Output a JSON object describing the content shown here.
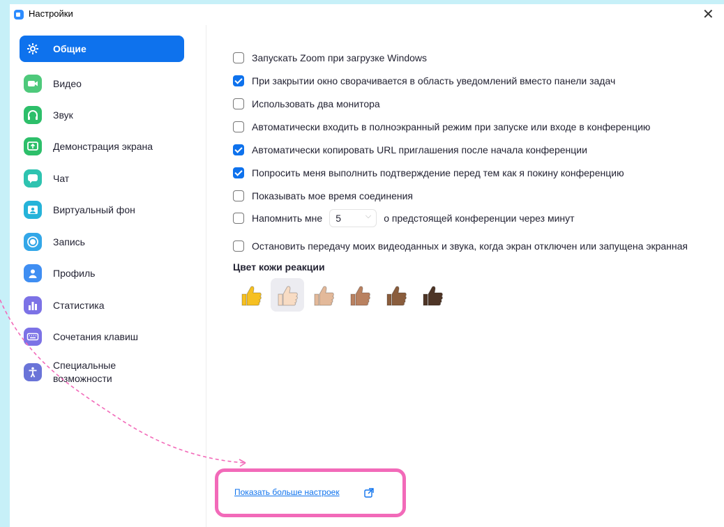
{
  "window": {
    "title": "Настройки"
  },
  "sidebar": {
    "items": [
      {
        "label": "Общие",
        "icon": "gear-icon",
        "color": "#0e72ed",
        "active": true
      },
      {
        "label": "Видео",
        "icon": "video-icon",
        "color": "#4ec97b"
      },
      {
        "label": "Звук",
        "icon": "headphones-icon",
        "color": "#2dbf6a"
      },
      {
        "label": "Демонстрация экрана",
        "icon": "share-screen-icon",
        "color": "#2dbf6a"
      },
      {
        "label": "Чат",
        "icon": "chat-icon",
        "color": "#2ec3b0"
      },
      {
        "label": "Виртуальный фон",
        "icon": "virtual-background-icon",
        "color": "#26b3d9"
      },
      {
        "label": "Запись",
        "icon": "record-icon",
        "color": "#33a7e8"
      },
      {
        "label": "Профиль",
        "icon": "profile-icon",
        "color": "#3f8ef2"
      },
      {
        "label": "Статистика",
        "icon": "statistics-icon",
        "color": "#7c72e6"
      },
      {
        "label": "Сочетания клавиш",
        "icon": "keyboard-icon",
        "color": "#7c72e6"
      },
      {
        "label_line1": "Специальные",
        "label_line2": "возможности",
        "icon": "accessibility-icon",
        "color": "#6a74d8"
      }
    ]
  },
  "general": {
    "options": [
      {
        "label": "Запускать Zoom при загрузке Windows",
        "checked": false
      },
      {
        "label": "При закрытии окно сворачивается в область уведомлений вместо панели задач",
        "checked": true
      },
      {
        "label": "Использовать два монитора",
        "checked": false
      },
      {
        "label": "Автоматически входить в полноэкранный режим при запуске или входе в конференцию",
        "checked": false
      },
      {
        "label": "Автоматически копировать URL приглашения после начала конференции",
        "checked": true
      },
      {
        "label": "Попросить меня выполнить подтверждение перед тем как я покину конференцию",
        "checked": true
      },
      {
        "label": "Показывать мое время соединения",
        "checked": false
      }
    ],
    "reminder": {
      "label_before": "Напомнить мне",
      "minutes": "5",
      "label_after": "о предстоящей конференции через минут",
      "checked": false
    },
    "stop_video": {
      "label": "Остановить передачу моих видеоданных и звука, когда экран отключен или запущена экранная",
      "checked": false
    },
    "skin_tone": {
      "title": "Цвет кожи реакции",
      "tones": [
        "#f6c021",
        "#f8dcc4",
        "#e3b99a",
        "#b98160",
        "#8a5d3d",
        "#4e3526"
      ],
      "selected_index": 1
    },
    "more_settings_link": "Показать больше настроек"
  },
  "colors": {
    "accent": "#0e72ed",
    "highlight": "#f26ab9",
    "background": "#c7f0f8"
  }
}
